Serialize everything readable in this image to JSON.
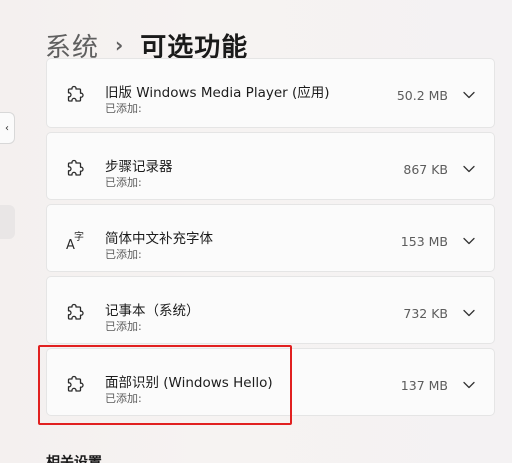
{
  "breadcrumb": {
    "parent": "系统",
    "separator": "›",
    "current": "可选功能"
  },
  "features": [
    {
      "title": "旧版 Windows Media Player (应用)",
      "status": "已添加:",
      "size": "50.2 MB",
      "icon": "puzzle-icon"
    },
    {
      "title": "步骤记录器",
      "status": "已添加:",
      "size": "867 KB",
      "icon": "puzzle-icon"
    },
    {
      "title": "简体中文补充字体",
      "status": "已添加:",
      "size": "153 MB",
      "icon": "font-icon"
    },
    {
      "title": "记事本（系统）",
      "status": "已添加:",
      "size": "732 KB",
      "icon": "puzzle-icon"
    },
    {
      "title": "面部识别 (Windows Hello)",
      "status": "已添加:",
      "size": "137 MB",
      "icon": "puzzle-icon"
    }
  ],
  "related_settings": {
    "title": "相关设置"
  },
  "colors": {
    "highlight": "#e12020"
  }
}
